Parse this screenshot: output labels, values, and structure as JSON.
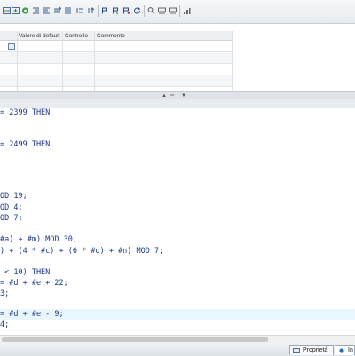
{
  "toolbar": {
    "icons": [
      "insert-row-icon",
      "add-row-icon",
      "delete-row-icon",
      "compile-icon",
      "indent-left-icon",
      "indent-right-icon",
      "outdent-icon",
      "list-icon",
      "align-icon",
      "monitor-icon",
      "go-back-icon",
      "go-forward-icon",
      "refresh-icon",
      "find-icon",
      "abs-icon",
      "xor-icon",
      "goto-icon",
      "network-icon"
    ]
  },
  "table": {
    "columns": [
      "Valore di default",
      "Controllo",
      "Commento"
    ]
  },
  "code_lines": [
    {
      "text": "= 2399 THEN"
    },
    {
      "text": ""
    },
    {
      "text": ""
    },
    {
      "text": "= 2499 THEN"
    },
    {
      "text": ""
    },
    {
      "text": ""
    },
    {
      "text": ""
    },
    {
      "text": ""
    },
    {
      "text": "OD 19;"
    },
    {
      "text": "OD 4;"
    },
    {
      "text": "OD 7;"
    },
    {
      "text": ""
    },
    {
      "text": "#a) + #m) MOD 30;"
    },
    {
      "text": ") + (4 * #c) + (6 * #d) + #n) MOD 7;"
    },
    {
      "text": ""
    },
    {
      "text": " < 10) THEN"
    },
    {
      "text": "= #d + #e + 22;"
    },
    {
      "text": "3;"
    },
    {
      "text": ""
    },
    {
      "text": "= #d + #e - 9;"
    },
    {
      "text": "4;"
    }
  ],
  "tabs": {
    "properties": "Proprietà",
    "info": "In"
  },
  "colors": {
    "code_text": "#1c3a8a",
    "highlight": "#e9f6fb"
  }
}
